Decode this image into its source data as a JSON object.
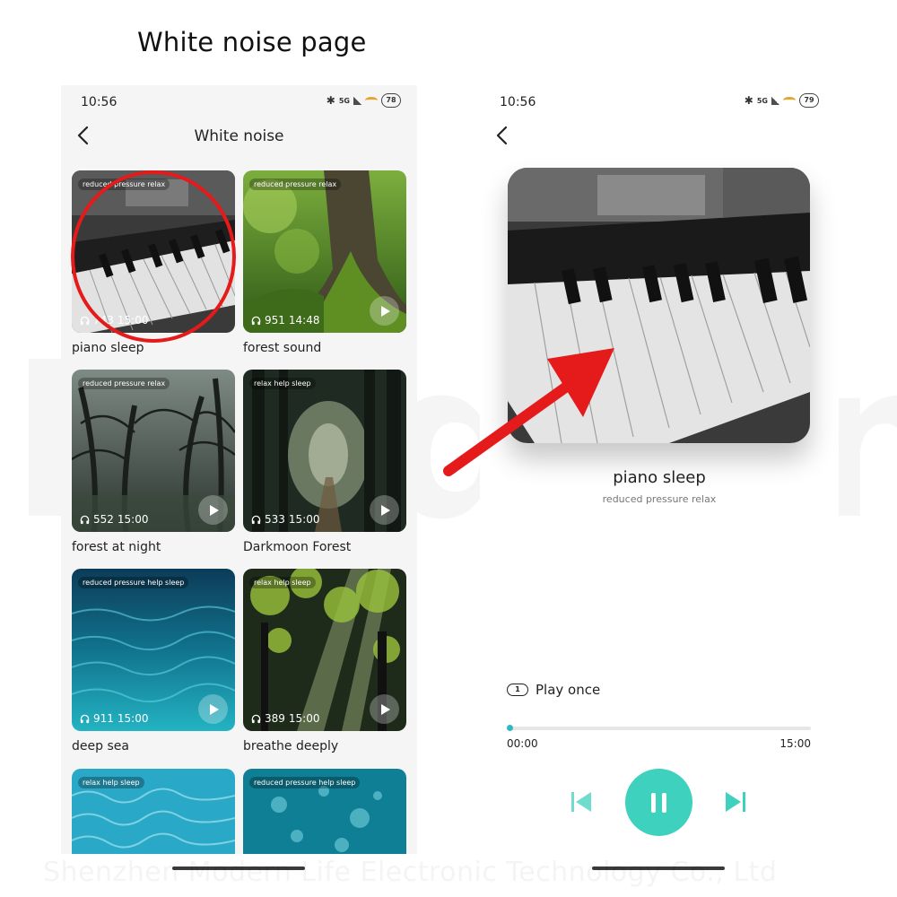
{
  "heading": "White noise page",
  "watermark": "Modern",
  "footer_mark": "Shenzhen Modern Life Electronic Technology Co., Ltd",
  "colors": {
    "accent": "#3dd1be",
    "annotation": "#e51a1a"
  },
  "left_phone": {
    "status": {
      "time": "10:56",
      "signal": "5G",
      "battery": "78"
    },
    "title": "White noise",
    "cards": [
      {
        "tag": "reduced pressure  relax",
        "plays": "743",
        "duration": "15:00",
        "label": "piano sleep",
        "theme": "piano"
      },
      {
        "tag": "reduced pressure  relax",
        "plays": "951",
        "duration": "14:48",
        "label": "forest sound",
        "theme": "moss"
      },
      {
        "tag": "reduced pressure  relax",
        "plays": "552",
        "duration": "15:00",
        "label": "forest at night",
        "theme": "darkwood"
      },
      {
        "tag": "relax  help sleep",
        "plays": "533",
        "duration": "15:00",
        "label": "Darkmoon Forest",
        "theme": "path"
      },
      {
        "tag": "reduced pressure  help sleep",
        "plays": "911",
        "duration": "15:00",
        "label": "deep sea",
        "theme": "sea"
      },
      {
        "tag": "relax  help sleep",
        "plays": "389",
        "duration": "15:00",
        "label": "breathe deeply",
        "theme": "rays"
      },
      {
        "tag": "relax  help sleep",
        "label": "",
        "theme": "pool"
      },
      {
        "tag": "reduced pressure  help sleep",
        "label": "",
        "theme": "bubbles"
      }
    ]
  },
  "right_phone": {
    "status": {
      "time": "10:56",
      "signal": "5G",
      "battery": "79"
    },
    "track": {
      "title": "piano sleep",
      "subtitle": "reduced pressure relax"
    },
    "play_mode": {
      "badge": "1",
      "label": "Play once"
    },
    "progress": {
      "current": "00:00",
      "total": "15:00",
      "fraction": 0.0
    }
  }
}
